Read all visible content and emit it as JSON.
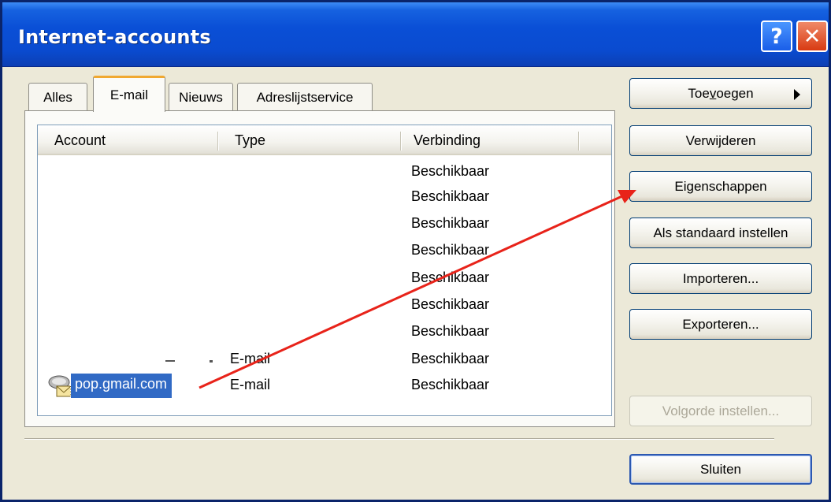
{
  "window": {
    "title": "Internet-accounts",
    "help_glyph": "?",
    "close_glyph": "✕"
  },
  "tabs": [
    {
      "label": "Alles",
      "active": false
    },
    {
      "label": "E-mail",
      "active": true
    },
    {
      "label": "Nieuws",
      "active": false
    },
    {
      "label": "Adreslijstservice",
      "active": false
    }
  ],
  "list": {
    "columns": [
      "Account",
      "Type",
      "Verbinding"
    ],
    "rows": [
      {
        "account": "",
        "type": "",
        "connection": "Beschikbaar"
      },
      {
        "account": "",
        "type": "",
        "connection": "Beschikbaar"
      },
      {
        "account": "",
        "type": "",
        "connection": "Beschikbaar"
      },
      {
        "account": "",
        "type": "",
        "connection": "Beschikbaar"
      },
      {
        "account": "",
        "type": "",
        "connection": "Beschikbaar"
      },
      {
        "account": "",
        "type": "",
        "connection": "Beschikbaar"
      },
      {
        "account": "",
        "type": "",
        "connection": "Beschikbaar"
      },
      {
        "account": "",
        "type": "E-mail",
        "connection": "Beschikbaar"
      },
      {
        "account": "pop.gmail.com",
        "type": "E-mail",
        "connection": "Beschikbaar",
        "selected": true,
        "icon": "mail-account-icon"
      }
    ]
  },
  "buttons": {
    "add": {
      "pre": "Toe",
      "accel": "v",
      "post": "oegen"
    },
    "remove": "Verwijderen",
    "properties": "Eigenschappen",
    "set_default": "Als standaard instellen",
    "import": "Importeren...",
    "export": "Exporteren...",
    "set_order": "Volgorde instellen...",
    "close": "Sluiten"
  },
  "annotation": {
    "arrow_color": "#e8231a",
    "from": "pop.gmail.com",
    "to": "Eigenschappen"
  },
  "colors": {
    "selection": "#316ac5",
    "titlebar": "#0a4fd6",
    "face": "#ece9d8"
  }
}
